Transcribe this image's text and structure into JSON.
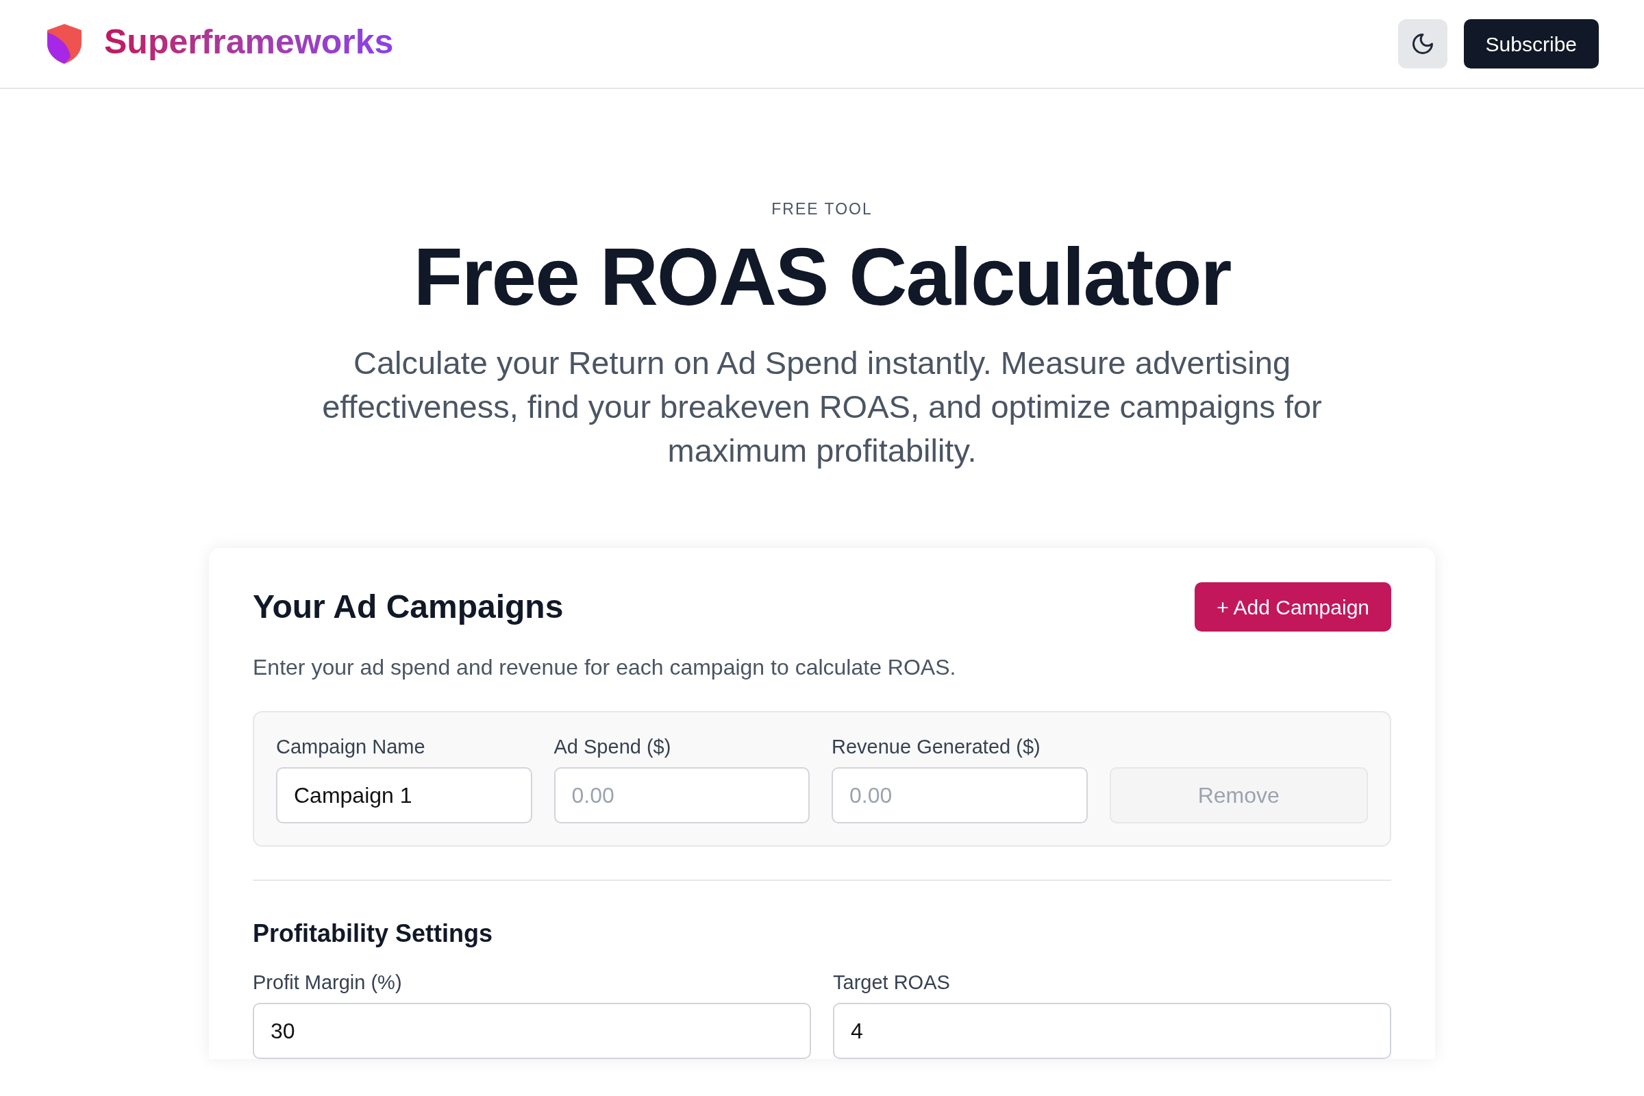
{
  "header": {
    "brand": "Superframeworks",
    "subscribe": "Subscribe"
  },
  "hero": {
    "eyebrow": "FREE TOOL",
    "title": "Free ROAS Calculator",
    "subtitle": "Calculate your Return on Ad Spend instantly. Measure advertising effectiveness, find your breakeven ROAS, and optimize campaigns for maximum profitability."
  },
  "campaigns": {
    "title": "Your Ad Campaigns",
    "add_button": "+ Add Campaign",
    "description": "Enter your ad spend and revenue for each campaign to calculate ROAS.",
    "rows": [
      {
        "fields": [
          {
            "label": "Campaign Name",
            "value": "Campaign 1"
          },
          {
            "label": "Ad Spend ($)",
            "placeholder": "0.00"
          },
          {
            "label": "Revenue Generated ($)",
            "placeholder": "0.00"
          }
        ],
        "remove": "Remove",
        "remove_disabled": true
      }
    ]
  },
  "profitability": {
    "title": "Profitability Settings",
    "fields": [
      {
        "label": "Profit Margin (%)",
        "value": "30"
      },
      {
        "label": "Target ROAS",
        "value": "4"
      }
    ]
  }
}
